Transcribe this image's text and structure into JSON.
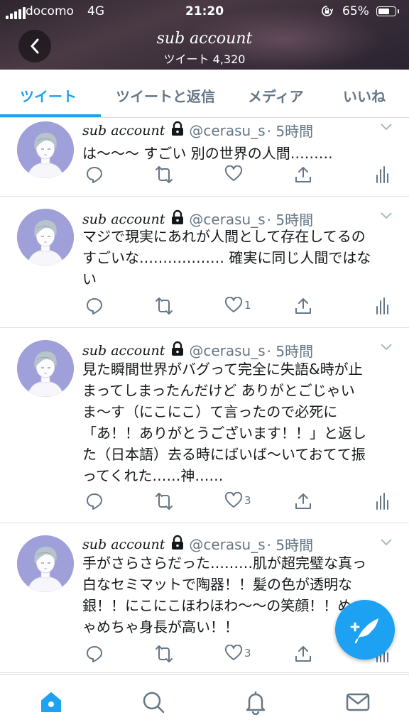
{
  "status_bar": {
    "carrier": "docomo",
    "network": "4G",
    "time": "21:20",
    "battery": "65%"
  },
  "header": {
    "title": "sub account",
    "subtitle": "ツイート 4,320"
  },
  "tabs": [
    {
      "label": "ツイート",
      "active": true
    },
    {
      "label": "ツイートと返信",
      "active": false
    },
    {
      "label": "メディア",
      "active": false
    },
    {
      "label": "いいね",
      "active": false
    }
  ],
  "tweets": [
    {
      "name": "sub account",
      "handle": "@cerasu_s",
      "time": "· 5時間",
      "lines": [
        "は〜〜〜 すごい 別の世界の人間………"
      ],
      "likes": ""
    },
    {
      "name": "sub account",
      "handle": "@cerasu_s",
      "time": "· 5時間",
      "lines": [
        "マジで現実にあれが人間として存在してるの",
        "すごいな……………… 確実に同じ人間ではな",
        "い"
      ],
      "likes": "1"
    },
    {
      "name": "sub account",
      "handle": "@cerasu_s",
      "time": "· 5時間",
      "lines": [
        "見た瞬間世界がバグって完全に失語&時が止",
        "まってしまったんだけど ありがとごじゃい",
        "ま〜す（にこにこ）て言ったので必死に",
        "「あ！！ありがとうございます！！」と返し",
        "た（日本語）去る時にばいば〜いておてて振",
        "ってくれた……神……"
      ],
      "likes": "3"
    },
    {
      "name": "sub account",
      "handle": "@cerasu_s",
      "time": "· 5時間",
      "lines": [
        "手がさらさらだった………肌が超完璧な真っ",
        "白なセミマットで陶器！！髪の色が透明な",
        "銀！！にこにこほわほわ〜〜の笑顔！！め",
        "ゃめちゃ身長が高い！！"
      ],
      "likes": "3"
    }
  ],
  "colors": {
    "accent": "#1da1f2",
    "secondary_text": "#657786",
    "avatar_bg": "#9fa0d9"
  },
  "icons": {
    "back": "chevron-left-icon",
    "reply": "reply-icon",
    "retweet": "retweet-icon",
    "like": "heart-icon",
    "share": "share-icon",
    "analytics": "analytics-icon",
    "protected": "lock-icon",
    "compose": "compose-icon",
    "nav": [
      "home-icon",
      "search-icon",
      "notifications-icon",
      "messages-icon"
    ]
  }
}
